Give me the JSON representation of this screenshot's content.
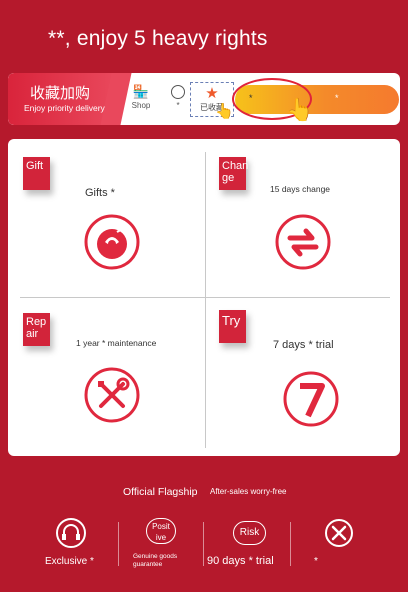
{
  "header": {
    "title": "**, enjoy 5 heavy rights"
  },
  "banner": {
    "main": "收藏加购",
    "sub": "Enjoy priority delivery",
    "shop_label": "Shop",
    "service_label": "*",
    "fav_label": "已收藏",
    "pill_left": "*",
    "pill_right": "*"
  },
  "cards": [
    {
      "tag": "Gift",
      "label": "Gifts *",
      "icon": "gift-icon"
    },
    {
      "tag": "Chan ge",
      "label": "15 days change",
      "icon": "exchange-arrows-icon"
    },
    {
      "tag": "Rep air",
      "label": "1 year * maintenance",
      "icon": "wrench-screwdriver-icon"
    },
    {
      "tag": "Try",
      "label": "7 days * trial",
      "icon": "number-seven-icon"
    }
  ],
  "footer": {
    "title": "Official Flagship",
    "subtitle": "After-sales worry-free",
    "items": [
      {
        "label": "Exclusive *",
        "icon": "headset-icon"
      },
      {
        "badge": "Posit ive",
        "label": "Genuine goods guarantee"
      },
      {
        "badge": "Risk",
        "label": "90 days * trial"
      },
      {
        "label": "*",
        "icon": "tools-icon"
      }
    ]
  },
  "colors": {
    "background": "#b5192c",
    "accent": "#d2243a",
    "pill": "#f48a2a"
  }
}
